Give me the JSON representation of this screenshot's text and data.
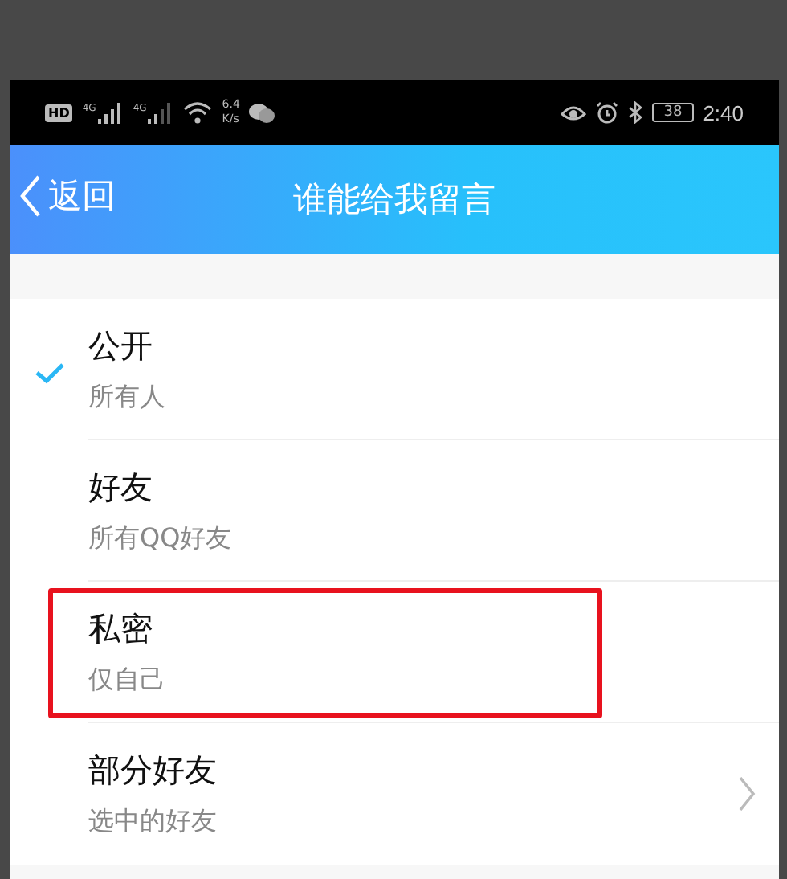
{
  "status_bar": {
    "hd": "HD",
    "signals": [
      "4G",
      "4G"
    ],
    "speed_value": "6.4",
    "speed_unit": "K/s",
    "battery": "38",
    "time": "2:40"
  },
  "header": {
    "back": "返回",
    "title": "谁能给我留言"
  },
  "options": [
    {
      "title": "公开",
      "subtitle": "所有人",
      "selected": true,
      "kind": "plain",
      "highlighted": false
    },
    {
      "title": "好友",
      "subtitle": "所有QQ好友",
      "selected": false,
      "kind": "plain",
      "highlighted": false
    },
    {
      "title": "私密",
      "subtitle": "仅自己",
      "selected": false,
      "kind": "plain",
      "highlighted": true
    },
    {
      "title": "部分好友",
      "subtitle": "选中的好友",
      "selected": false,
      "kind": "submenu",
      "highlighted": false
    }
  ]
}
